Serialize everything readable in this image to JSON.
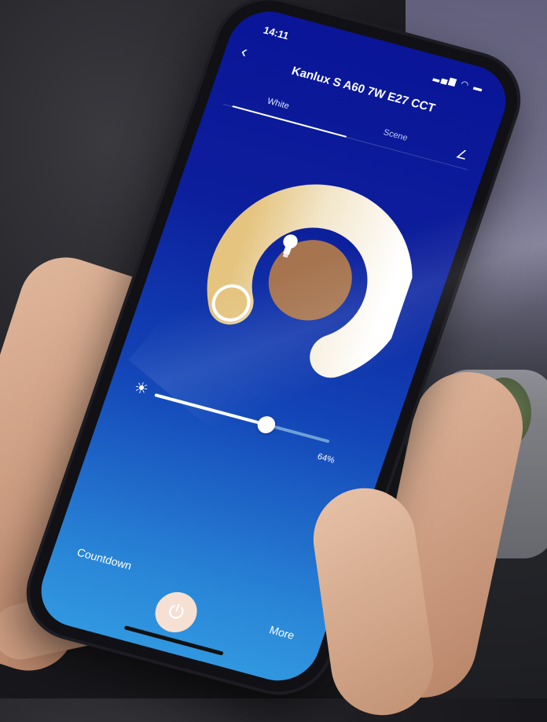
{
  "status": {
    "time": "14:11",
    "icons": "▂▄▆ ◠ ▬"
  },
  "header": {
    "back": "‹",
    "title": "Kanlux S A60 7W E27 CCT",
    "edit": "∠"
  },
  "tabs": [
    {
      "label": "White"
    },
    {
      "label": "Scene"
    }
  ],
  "colors": {
    "warm": "#e4c47f",
    "cool": "#ffffff",
    "center": "#a6744f",
    "screen_top": "#0a1597",
    "screen_bottom": "#3197e0"
  },
  "brightness": {
    "icon": "☀",
    "value_label": "64%",
    "fraction": 0.64
  },
  "bottom": {
    "countdown": "Countdown",
    "more": "More",
    "power_icon": "power-icon"
  }
}
